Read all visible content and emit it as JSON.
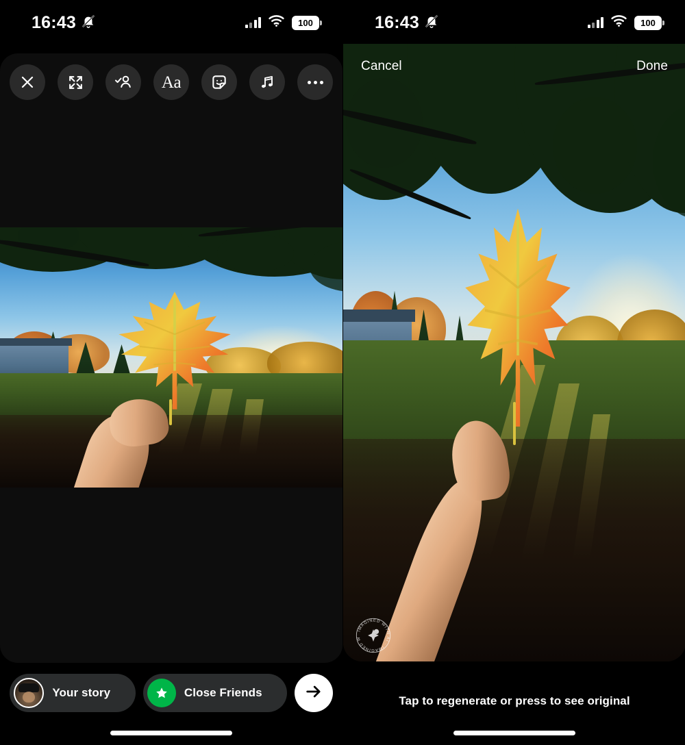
{
  "status_bar": {
    "time": "16:43",
    "bell_icon": "bell-slash-icon",
    "signal_icon": "cellular-bars-icon",
    "wifi_icon": "wifi-icon",
    "battery_level": "100"
  },
  "left_panel": {
    "name": "story-editor",
    "toolbar": {
      "close_label": "close-icon",
      "items": [
        {
          "name": "expand-icon",
          "label": "Expand"
        },
        {
          "name": "tag-people-icon",
          "label": "Tag people"
        },
        {
          "name": "text-icon",
          "label": "Aa"
        },
        {
          "name": "sticker-icon",
          "label": "Sticker"
        },
        {
          "name": "music-icon",
          "label": "Music"
        },
        {
          "name": "more-options-icon",
          "label": "More"
        }
      ]
    },
    "share_bar": {
      "your_story_label": "Your story",
      "close_friends_label": "Close Friends",
      "close_friends_color": "#00b548",
      "send_icon": "arrow-right-icon",
      "avatar": "user-avatar"
    }
  },
  "right_panel": {
    "name": "ai-expand-preview",
    "cancel_label": "Cancel",
    "done_label": "Done",
    "hint_text": "Tap to regenerate or press to see original",
    "watermark_text": "IMAGINED WITH AI"
  },
  "photo": {
    "description": "Hand holding an orange autumn maple leaf in a sunlit backyard with a blue house, chain-link fence and fall foliage",
    "leaf_colors": [
      "#f0a23a",
      "#e8652a",
      "#f2c93f",
      "#c8d24a"
    ],
    "sky_color": "#55a0d8",
    "grass_color": "#4b6a27"
  }
}
